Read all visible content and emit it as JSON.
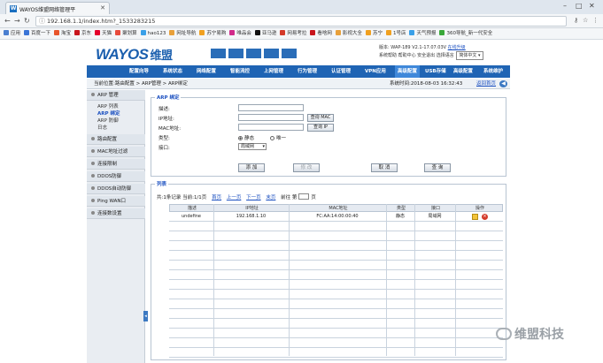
{
  "browser": {
    "tab_title": "WAYOS维盟网络管理平",
    "url": "192.168.1.1/index.htm?_1533283215",
    "bookmarks": [
      "应用",
      "百度一下",
      "淘宝",
      "京东",
      "天猫",
      "聚划算",
      "hao123",
      "网址导航",
      "苏宁易购",
      "唯品会",
      "亚马逊",
      "网易考拉",
      "看啥网",
      "影视大全",
      "苏宁",
      "1号店",
      "天气预报",
      "360导航_新一代安全"
    ],
    "bookmark_colors": [
      "#4a7fd0",
      "#3a74d6",
      "#e8552c",
      "#c8161d",
      "#e4002b",
      "#e84c3d",
      "#3aa0e8",
      "#e8a03a",
      "#f0a020",
      "#d12a8a",
      "#111111",
      "#d43a2a",
      "#c8161d",
      "#e8a03a",
      "#f0a020",
      "#f0a020",
      "#3aa0e8",
      "#3aa83a"
    ]
  },
  "header": {
    "logo": "WAYOS",
    "logo_cn": "维盟",
    "version_label": "版本: WAP-189 V2.1-17.07.03V",
    "online_update": "在线升级",
    "links": "系统帮助  帮助中心  安全退出  选择语言",
    "language": "简体中文"
  },
  "menu": [
    "配置向导",
    "系统状态",
    "网络配置",
    "智能流控",
    "上网管理",
    "行为管理",
    "认证管理",
    "VPN应用",
    "高级配置",
    "USB存储",
    "高级配置",
    "系统维护"
  ],
  "menu_active_index": 8,
  "crumb": "当前位置:路由配置 > ARP管理 > ARP绑定",
  "systime": "系统时间:2018-08-03 16:32:43",
  "home_link": "返回首页",
  "sidebar": {
    "group1": "ARP 管理",
    "group1_items": [
      "ARP 列表",
      "ARP 绑定",
      "ARP 防御",
      "日志"
    ],
    "active_item": 1,
    "groups": [
      "路由配置",
      "MAC地址过滤",
      "连接限制",
      "DDOS防御",
      "DDOS自动防御",
      "Ping WAN口",
      "连接数设置"
    ]
  },
  "form": {
    "legend": "ARP 绑定",
    "desc_label": "描述:",
    "ip_label": "IP地址:",
    "mac_label": "MAC地址:",
    "type_label": "类型:",
    "iface_label": "接口:",
    "query_mac_btn": "查询 MAC",
    "query_ip_btn": "查询 IP",
    "type_static": "静态",
    "type_unique": "唯一",
    "iface_value": "局域网",
    "btn_add": "添 加",
    "btn_modify": "修 改",
    "btn_cancel": "取 消",
    "btn_query": "查 询"
  },
  "list": {
    "legend": "列表",
    "pager_info": "共:1条记录  当前:1/1页",
    "first": "首页",
    "prev": "上一页",
    "next": "下一页",
    "last": "末页",
    "goto": "前往 第",
    "page_suffix": "页",
    "columns": [
      "描述",
      "IP地址",
      "MAC地址",
      "类型",
      "接口",
      "操作"
    ],
    "rows": [
      {
        "desc": "undefine",
        "ip": "192.168.1.10",
        "mac": "FC:AA:14:00:00:40",
        "type": "静态",
        "iface": "局域网"
      }
    ]
  },
  "watermark": "维盟科技"
}
